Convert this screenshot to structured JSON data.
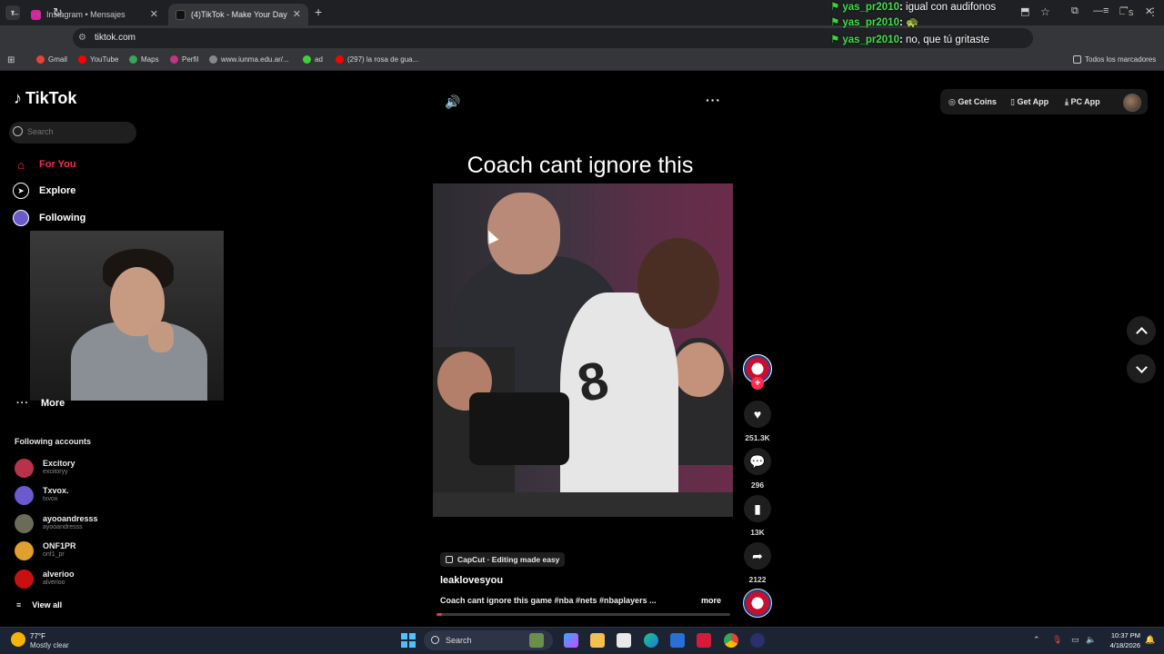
{
  "browser": {
    "tabs": [
      {
        "title": "Instagram • Mensajes",
        "active": false
      },
      {
        "title": "(4)TikTok - Make Your Day",
        "active": true
      }
    ],
    "new_tab_icon": "+",
    "url": "tiktok.com",
    "bookmarks": [
      {
        "label": "Gmail",
        "color": "#ea4335"
      },
      {
        "label": "YouTube",
        "color": "#ff0000"
      },
      {
        "label": "Maps",
        "color": "#34a853"
      },
      {
        "label": "Perfil",
        "color": "#c13584"
      },
      {
        "label": "www.iunma.edu.ar/...",
        "color": "#888888"
      },
      {
        "label": "ad",
        "color": "#3ad43a"
      },
      {
        "label": "(297) la rosa de gua...",
        "color": "#ff0000"
      }
    ],
    "all_bookmarks": "Todos los marcadores"
  },
  "chat": [
    {
      "user": "yas_pr2010",
      "message": "igual con audifonos"
    },
    {
      "user": "yas_pr2010",
      "message": "🐢"
    },
    {
      "user": "yas_pr2010",
      "message": "no, que tú gritaste"
    }
  ],
  "sidebar": {
    "logo": "TikTok",
    "search_placeholder": "Search",
    "nav": [
      {
        "label": "For You",
        "active": true
      },
      {
        "label": "Explore",
        "active": false
      },
      {
        "label": "Following",
        "active": false
      }
    ],
    "more_label": "More",
    "following_title": "Following accounts",
    "accounts": [
      {
        "name": "Excitory",
        "handle": "excitoryy",
        "color": "#b8324a"
      },
      {
        "name": "Txvox.",
        "handle": "txvox",
        "color": "#6a5acd"
      },
      {
        "name": "ayooandresss",
        "handle": "ayooandresss",
        "color": "#6b6b5a"
      },
      {
        "name": "ONF1PR",
        "handle": "onf1_pr",
        "color": "#e0a030"
      },
      {
        "name": "alverioo",
        "handle": "alverioo",
        "color": "#c81010"
      }
    ],
    "view_all": "View all"
  },
  "header": {
    "get_coins": "Get Coins",
    "get_app": "Get App",
    "pc_app": "PC App"
  },
  "video": {
    "title": "Coach cant ignore this",
    "jersey": "8",
    "effect": "CapCut · Editing made easy",
    "username": "leaklovesyou",
    "description": "Coach cant ignore this game #nba #nets #nbaplayers ...",
    "more": "more",
    "progress_percent": 2
  },
  "actions": {
    "likes": "251.3K",
    "comments": "296",
    "saves": "13K",
    "shares": "2122"
  },
  "taskbar": {
    "temp": "77°F",
    "weather": "Mostly clear",
    "search_label": "Search",
    "time": "10:37 PM",
    "date": "4/18/2026"
  }
}
